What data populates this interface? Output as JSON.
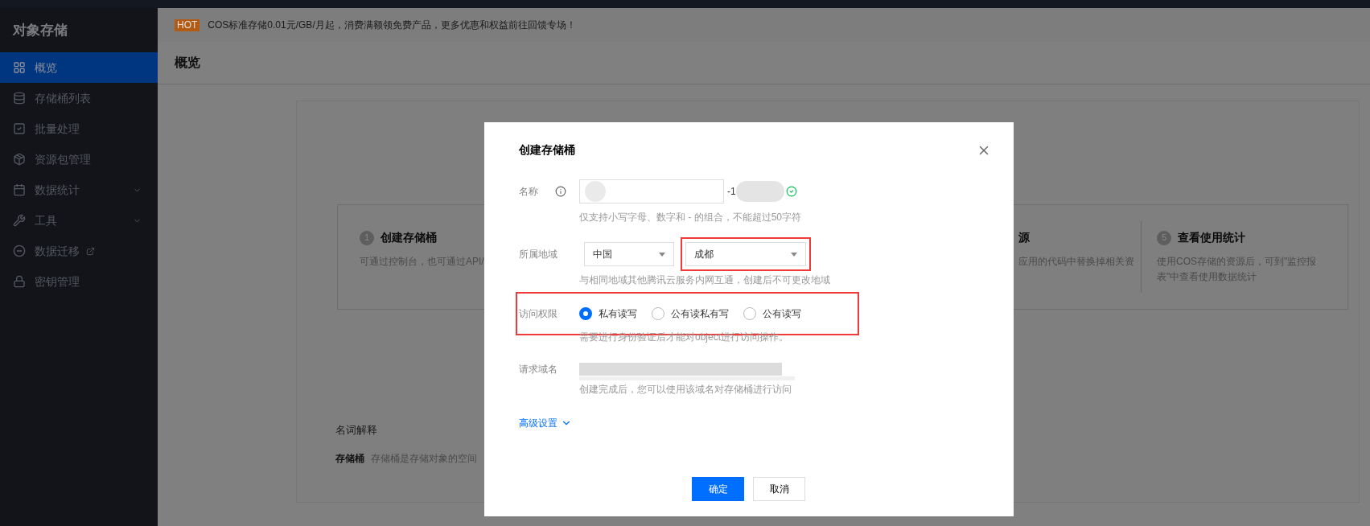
{
  "sidebar": {
    "title": "对象存储",
    "items": [
      {
        "label": "概览",
        "selected": true,
        "expandable": false,
        "external": false
      },
      {
        "label": "存储桶列表",
        "selected": false,
        "expandable": false,
        "external": false
      },
      {
        "label": "批量处理",
        "selected": false,
        "expandable": false,
        "external": false
      },
      {
        "label": "资源包管理",
        "selected": false,
        "expandable": false,
        "external": false
      },
      {
        "label": "数据统计",
        "selected": false,
        "expandable": true,
        "external": false
      },
      {
        "label": "工具",
        "selected": false,
        "expandable": true,
        "external": false
      },
      {
        "label": "数据迁移",
        "selected": false,
        "expandable": false,
        "external": true
      },
      {
        "label": "密钥管理",
        "selected": false,
        "expandable": false,
        "external": false
      }
    ]
  },
  "banner": {
    "badge": "HOT",
    "text": "COS标准存储0.01元/GB/月起，消费满额领免费产品，更多优惠和权益前往回馈专场！"
  },
  "page_title": "概览",
  "steps": [
    {
      "number": "1",
      "title": "创建存储桶",
      "description": "可通过控制台，也可通过API/"
    },
    {
      "title": "源",
      "description": "应用的代码中替换掉相关资"
    },
    {
      "number": "5",
      "title": "查看使用统计",
      "description": "使用COS存储的资源后，可到\"监控报表\"中查看使用数据统计"
    }
  ],
  "glossary": {
    "heading": "名词解释",
    "term": "存储桶",
    "definition": "存储桶是存储对象的空间"
  },
  "dialog": {
    "title": "创建存储桶",
    "fields": [
      {
        "kind": "name",
        "label": "名称",
        "suffix": "-1",
        "valid": true,
        "hint": "仅支持小写字母、数字和 - 的组合，不能超过50字符"
      },
      {
        "kind": "region",
        "label": "所属地域",
        "selects": [
          {
            "value": "中国",
            "highlighted": false
          },
          {
            "value": "成都",
            "highlighted": true
          }
        ],
        "hint": "与相同地域其他腾讯云服务内网互通，创建后不可更改地域"
      },
      {
        "kind": "radio",
        "label": "访问权限",
        "highlighted": true,
        "options": [
          {
            "label": "私有读写",
            "selected": true
          },
          {
            "label": "公有读私有写",
            "selected": false
          },
          {
            "label": "公有读写",
            "selected": false
          }
        ],
        "hint": "需要进行身份验证后才能对object进行访问操作。"
      },
      {
        "kind": "domain",
        "label": "请求域名",
        "hint": "创建完成后，您可以使用该域名对存储桶进行访问"
      }
    ],
    "advanced": "高级设置",
    "buttons": [
      {
        "label": "确定",
        "primary": true
      },
      {
        "label": "取消",
        "primary": false
      }
    ]
  }
}
